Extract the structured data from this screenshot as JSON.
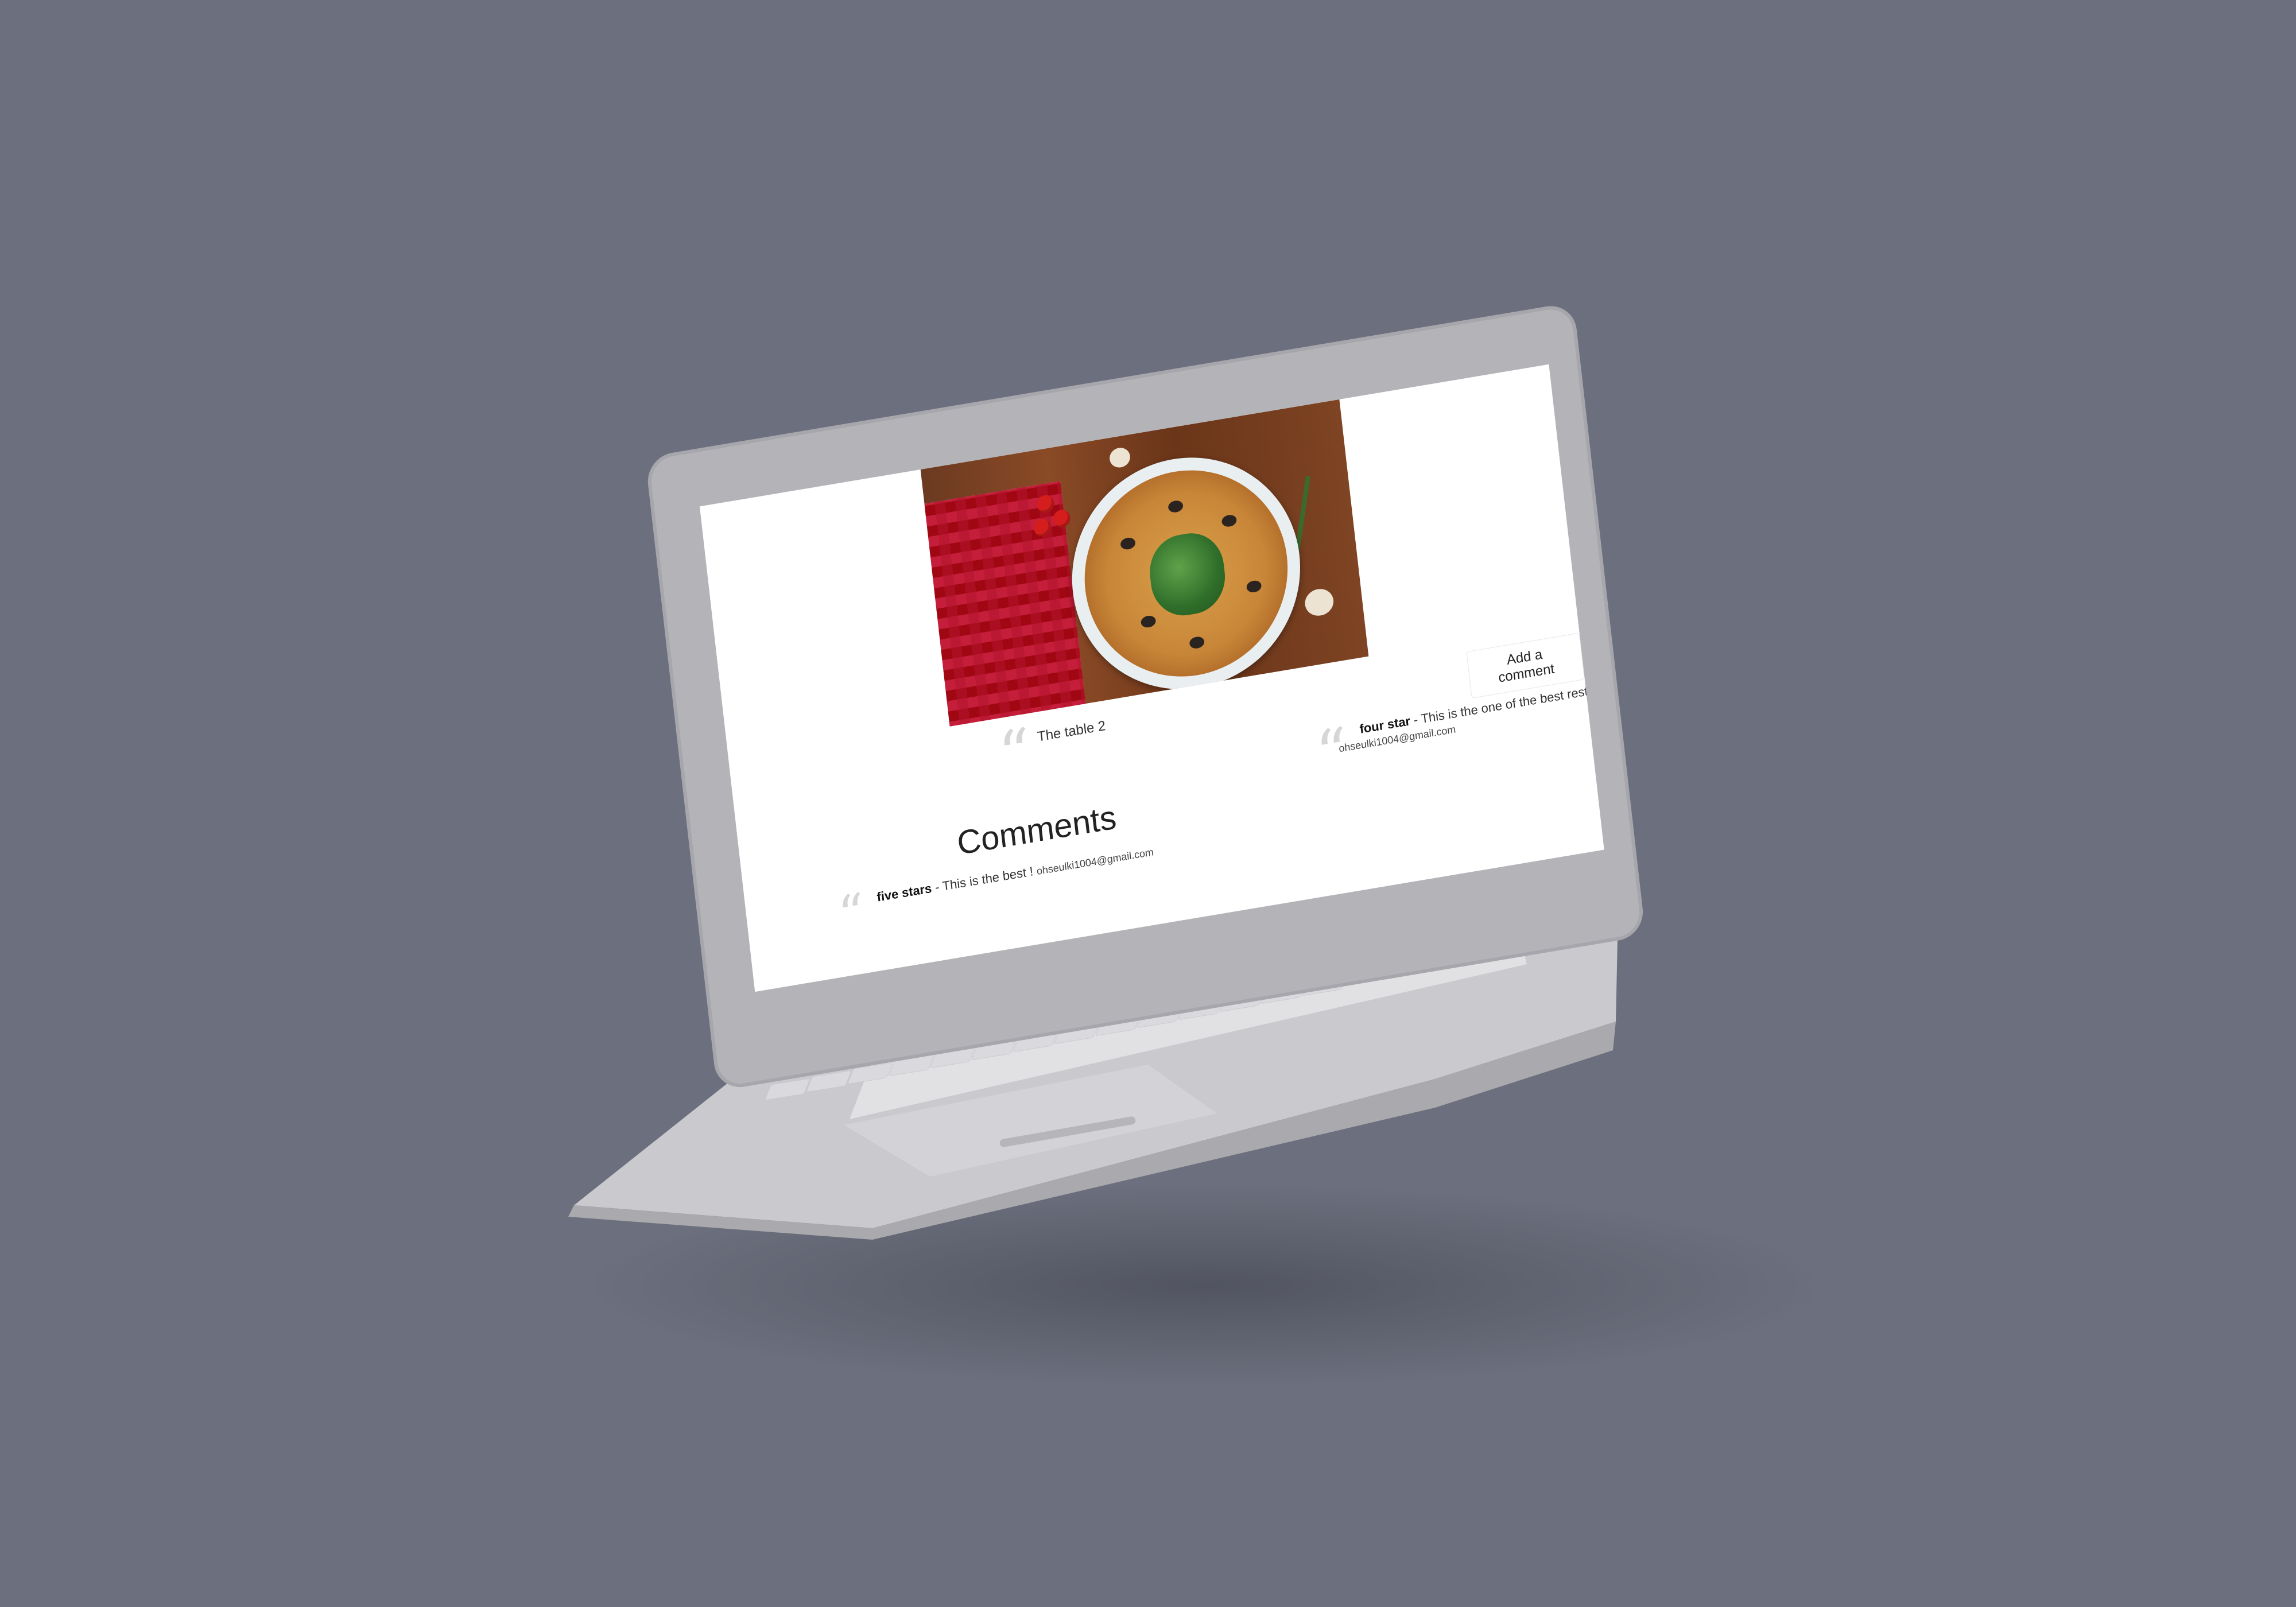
{
  "page": {
    "caption": "The table 2",
    "add_comment_label": "Add a comment",
    "comments_heading": "Comments"
  },
  "comments": [
    {
      "rating": "four star",
      "separator": " - ",
      "text": "This is the one of the best restaurant in CA",
      "email": "ohseulki1004@gmail.com"
    },
    {
      "rating": "five stars",
      "separator": " - ",
      "text": "This is the best ! ",
      "email": "ohseulki1004@gmail.com"
    }
  ],
  "icons": [
    "quote-mark-icon"
  ],
  "colors": {
    "background": "#6c707e",
    "laptop": "#b3b3b8",
    "screen": "#ffffff"
  }
}
